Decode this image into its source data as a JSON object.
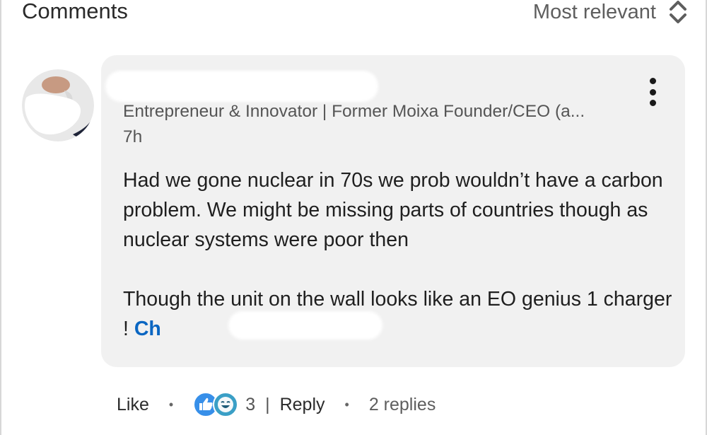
{
  "header": {
    "title": "Comments",
    "sort_label": "Most relevant"
  },
  "comment": {
    "headline": "Entrepreneur & Innovator | Former Moixa Founder/CEO (a...",
    "time": "7h",
    "body_paragraph_1": "Had we gone nuclear in 70s we prob wouldn’t have a carbon problem. We might be missing parts of countries though as nuclear systems were poor then",
    "body_paragraph_2": "Though the unit on the wall looks like an EO genius 1 charger !",
    "mention": "Ch",
    "reaction_icons": [
      "like-icon",
      "funny-icon"
    ],
    "reaction_count": "3"
  },
  "actions": {
    "like_label": "Like",
    "reply_label": "Reply",
    "replies_label": "2 replies",
    "separator": "|"
  },
  "colors": {
    "bubble_bg": "#f1f1f1",
    "link_blue": "#0a66c2",
    "text_muted": "#555555"
  }
}
